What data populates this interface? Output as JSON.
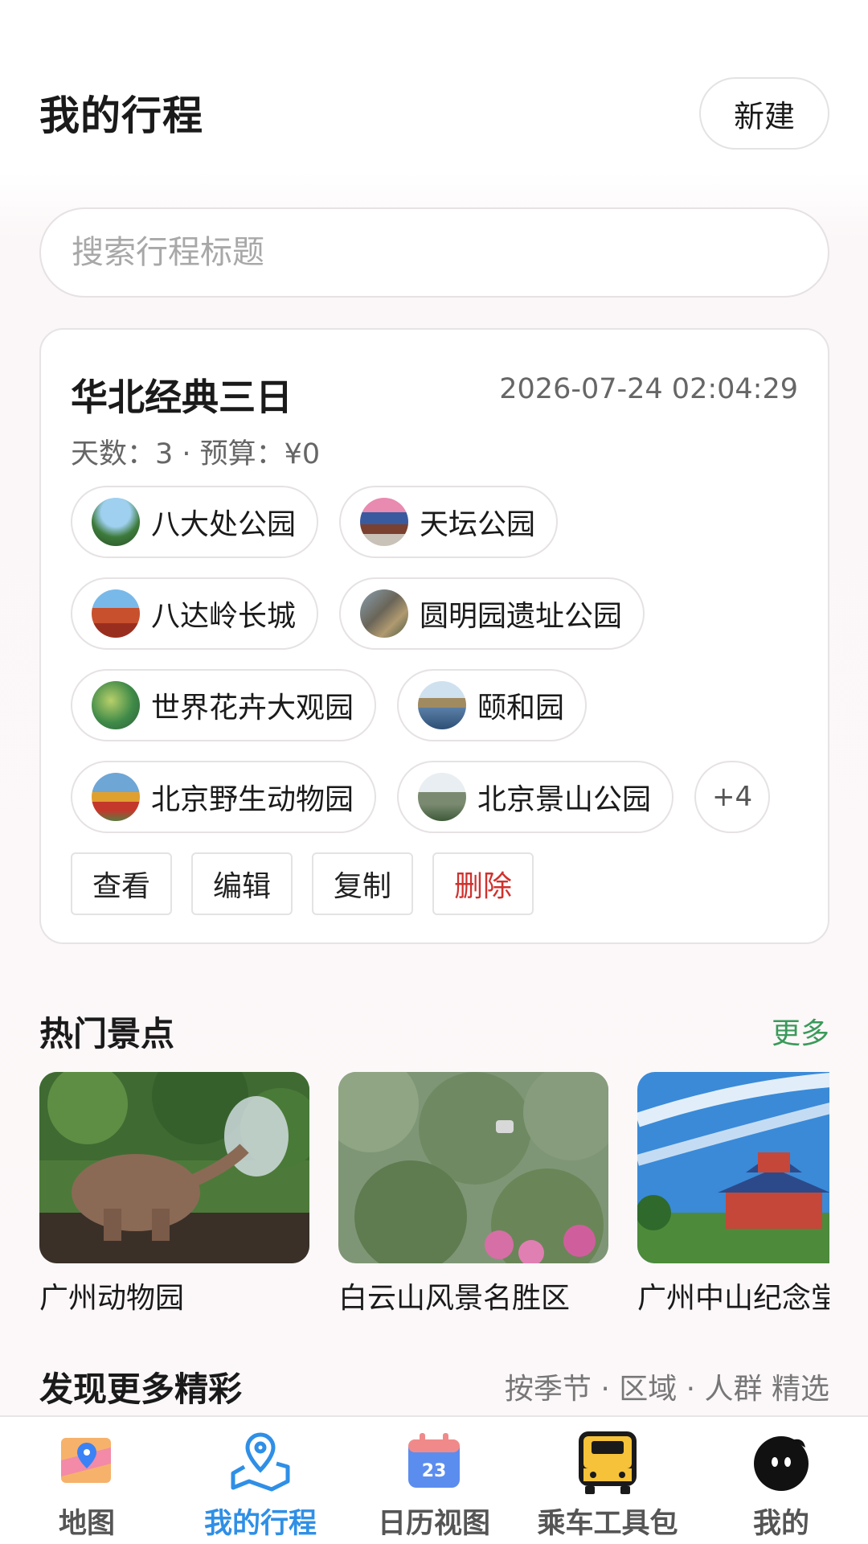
{
  "header": {
    "title": "我的行程",
    "new_label": "新建"
  },
  "search": {
    "placeholder": "搜索行程标题"
  },
  "trip": {
    "title": "华北经典三日",
    "time": "2026-07-24 02:04:29",
    "meta": "天数：3 · 预算：¥0",
    "spots": [
      "八大处公园",
      "天坛公园",
      "八达岭长城",
      "圆明园遗址公园",
      "世界花卉大观园",
      "颐和园",
      "北京野生动物园",
      "北京景山公园"
    ],
    "more": "+4",
    "actions": {
      "view": "查看",
      "edit": "编辑",
      "copy": "复制",
      "delete": "删除"
    }
  },
  "hot": {
    "title": "热门景点",
    "more": "更多",
    "items": [
      "广州动物园",
      "白云山风景名胜区",
      "广州中山纪念堂"
    ]
  },
  "discover": {
    "title": "发现更多精彩",
    "subtitle": "按季节 · 区域 · 人群 精选"
  },
  "tabs": [
    "地图",
    "我的行程",
    "日历视图",
    "乘车工具包",
    "我的"
  ],
  "calendar_day": "23",
  "colors": {
    "accent": "#2f8fe6",
    "more_green": "#3a9a5a",
    "danger": "#d0312d"
  }
}
